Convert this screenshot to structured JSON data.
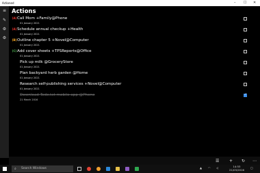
{
  "window": {
    "title": "Actioned"
  },
  "page": {
    "header": "Actions"
  },
  "colors": {
    "priority_red": "#e0322b",
    "priority_orange": "#f5a623",
    "priority_green": "#4caf50",
    "check_blue": "#3b8eea"
  },
  "tasks": [
    {
      "priority": "A",
      "priority_color": "#e0322b",
      "text": "Call Mom +Family@Phone",
      "date": "01 January 2021",
      "done": false
    },
    {
      "priority": "A",
      "priority_color": "#e0322b",
      "text": "Schedule annual checkup +Health",
      "date": "01 January 2021",
      "done": false
    },
    {
      "priority": "B",
      "priority_color": "#f5a623",
      "text": "Outline chapter 5 +Novel@Computer",
      "date": "01 January 2021",
      "done": false
    },
    {
      "priority": "C",
      "priority_color": "#4caf50",
      "text": "Add cover sheets +TPSReports@Office",
      "date": "01 January 2021",
      "done": false
    },
    {
      "priority": "",
      "priority_color": "",
      "text": "Pick up milk @GroceryStore",
      "date": "01 January 2021",
      "done": false
    },
    {
      "priority": "",
      "priority_color": "",
      "text": "Plan backyard herb garden @Home",
      "date": "01 January 2021",
      "done": false
    },
    {
      "priority": "",
      "priority_color": "",
      "text": "Research self-publishing services +Novel@Computer",
      "date": "01 January 2021",
      "done": false
    },
    {
      "priority": "",
      "priority_color": "",
      "text": "Download Todo.txt mobile app @Phone",
      "date": "21 March 2016",
      "done": true
    }
  ],
  "taskbar": {
    "search_placeholder": "Search Windows",
    "time": "14:53",
    "date": "21/03/2016"
  },
  "icons": {
    "menu": "hamburger-icon",
    "edit": "pencil-icon",
    "settings": "gear-icon",
    "add": "plus-icon",
    "sync": "refresh-icon"
  }
}
